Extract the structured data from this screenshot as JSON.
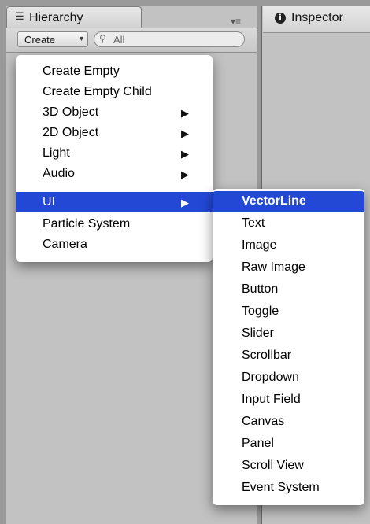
{
  "hierarchy": {
    "tab_label": "Hierarchy",
    "tab_icon": "list-icon",
    "menu_icon": "▾≡",
    "create_label": "Create",
    "search_value": "All",
    "search_icon": "search-icon"
  },
  "inspector": {
    "tab_label": "Inspector",
    "tab_icon": "info-icon"
  },
  "context_menu": {
    "items": [
      {
        "label": "Create Empty",
        "submenu": false
      },
      {
        "label": "Create Empty Child",
        "submenu": false
      },
      {
        "label": "3D Object",
        "submenu": true
      },
      {
        "label": "2D Object",
        "submenu": true
      },
      {
        "label": "Light",
        "submenu": true
      },
      {
        "label": "Audio",
        "submenu": true
      },
      {
        "label": "UI",
        "submenu": true,
        "highlighted": true
      },
      {
        "label": "Particle System",
        "submenu": false
      },
      {
        "label": "Camera",
        "submenu": false
      }
    ]
  },
  "ui_submenu": {
    "items": [
      {
        "label": "VectorLine",
        "highlighted": true
      },
      {
        "label": "Text"
      },
      {
        "label": "Image"
      },
      {
        "label": "Raw Image"
      },
      {
        "label": "Button"
      },
      {
        "label": "Toggle"
      },
      {
        "label": "Slider"
      },
      {
        "label": "Scrollbar"
      },
      {
        "label": "Dropdown"
      },
      {
        "label": "Input Field"
      },
      {
        "label": "Canvas"
      },
      {
        "label": "Panel"
      },
      {
        "label": "Scroll View"
      },
      {
        "label": "Event System"
      }
    ]
  },
  "colors": {
    "highlight": "#2448d6",
    "panel": "#c2c2c2",
    "background": "#9a9a9a"
  }
}
